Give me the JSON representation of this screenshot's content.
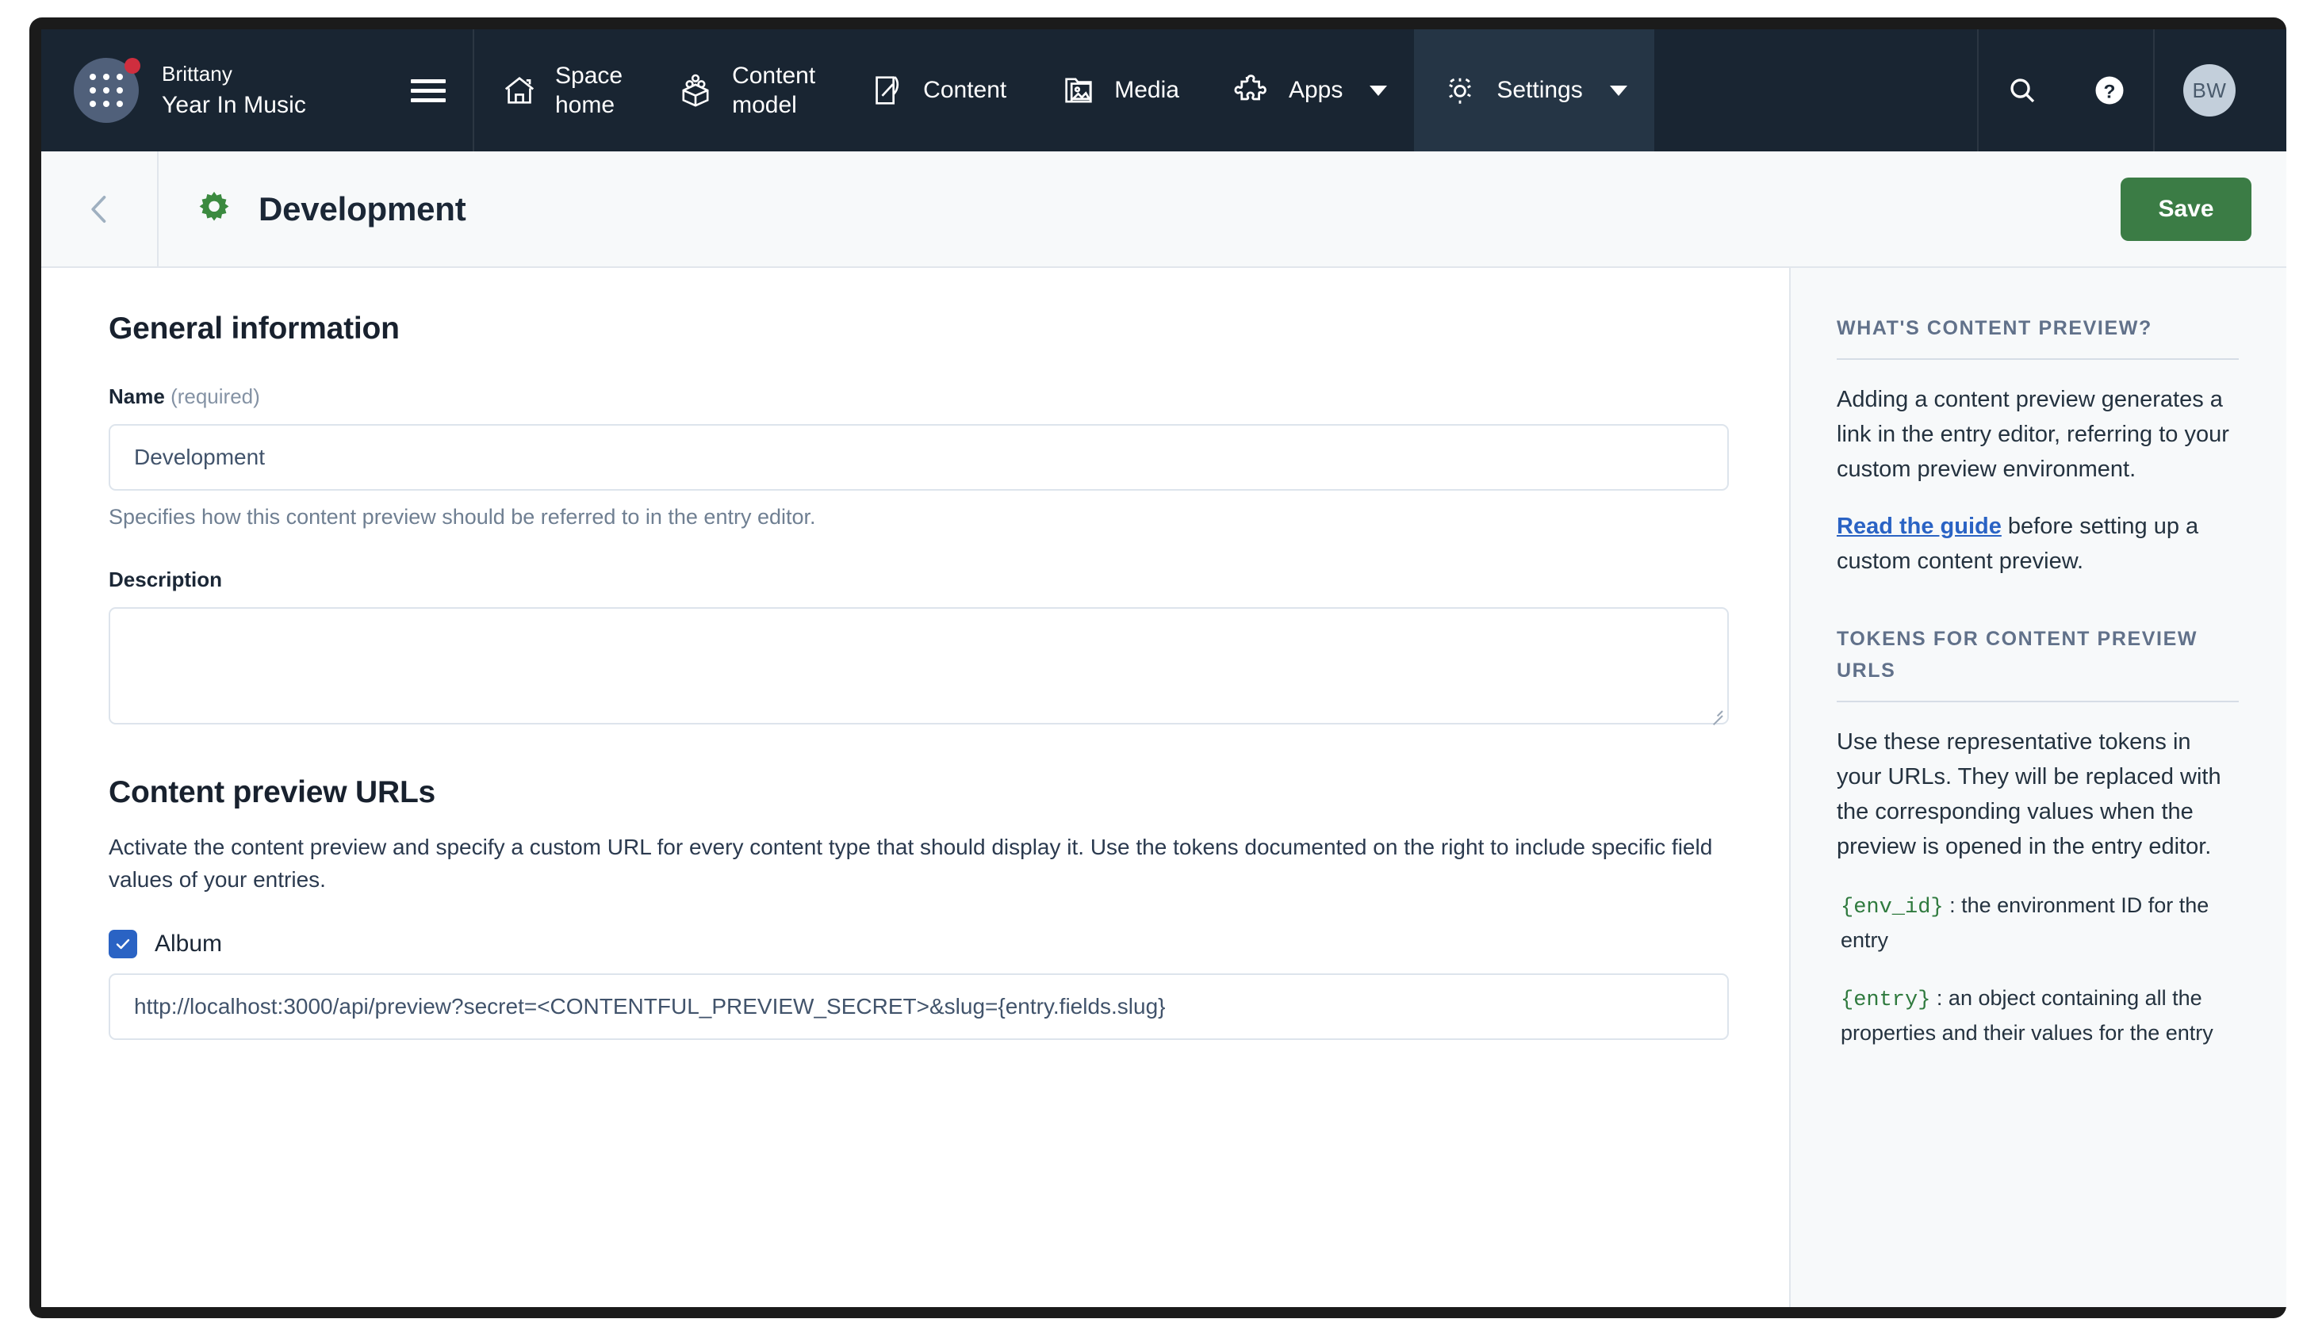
{
  "topnav": {
    "space": {
      "org_name": "Brittany",
      "space_name": "Year In Music",
      "grid_icon": "app-grid-icon",
      "menu_icon": "hamburger-menu-icon",
      "notification_badge": "notification-dot"
    },
    "items": [
      {
        "label": "Space\nhome",
        "label_line1": "Space",
        "label_line2": "home",
        "icon": "home-icon",
        "active": false,
        "caret": false
      },
      {
        "label": "Content\nmodel",
        "label_line1": "Content",
        "label_line2": "model",
        "icon": "content-model-icon",
        "active": false,
        "caret": false
      },
      {
        "label": "Content",
        "icon": "content-icon",
        "active": false,
        "caret": false
      },
      {
        "label": "Media",
        "icon": "media-icon",
        "active": false,
        "caret": false
      },
      {
        "label": "Apps",
        "icon": "apps-puzzle-icon",
        "active": false,
        "caret": true
      },
      {
        "label": "Settings",
        "icon": "gear-icon",
        "active": true,
        "caret": true
      }
    ],
    "search_icon": "search-icon",
    "help_icon": "help-question-icon",
    "user": {
      "initials": "BW",
      "caret_icon": "chevron-down-icon"
    },
    "colors": {
      "bar_bg": "#192532",
      "active_item_bg": "#253545",
      "badge_red": "#cf2e3e"
    }
  },
  "header": {
    "back_icon": "chevron-left-icon",
    "page_icon": "gear-icon",
    "title": "Development",
    "save_label": "Save",
    "save_color": "#3b7c45"
  },
  "main": {
    "general_title": "General information",
    "name_label": "Name",
    "name_required_note": "(required)",
    "name_value": "Development",
    "name_placeholder": "",
    "name_help": "Specifies how this content preview should be referred to in the entry editor.",
    "description_label": "Description",
    "description_value": "",
    "description_placeholder": "",
    "urls_title": "Content preview URLs",
    "urls_intro": "Activate the content preview and specify a custom URL for every content type that should display it. Use the tokens documented on the right to include specific field values of your entries.",
    "content_types": [
      {
        "name": "Album",
        "checked": true,
        "url": "http://localhost:3000/api/preview?secret=<CONTENTFUL_PREVIEW_SECRET>&slug={entry.fields.slug}",
        "url_placeholder": ""
      }
    ],
    "checkbox_color": "#2a63c4"
  },
  "sidebar": {
    "section1_heading": "WHAT'S CONTENT PREVIEW?",
    "section1_para": "Adding a content preview generates a link in the entry editor, referring to your custom preview environment.",
    "section1_link": "Read the guide",
    "section1_after_link": " before setting up a custom content preview.",
    "section2_heading": "TOKENS FOR CONTENT PREVIEW URLS",
    "section2_para": "Use these representative tokens in your URLs. They will be replaced with the corresponding values when the preview is opened in the entry editor.",
    "tokens": [
      {
        "token": "{env_id}",
        "description": " : the environment ID for the entry"
      },
      {
        "token": "{entry}",
        "description": " : an object containing all the properties and their values for the entry"
      }
    ],
    "link_color": "#2a63c4",
    "token_color": "#2f7a3e"
  }
}
